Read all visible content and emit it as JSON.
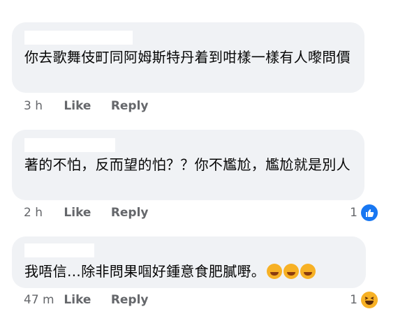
{
  "comments": [
    {
      "text": "你去歌舞伎町同阿姆斯特丹着到咁樣一樣有人嚟問價",
      "time": "3 h",
      "like_label": "Like",
      "reply_label": "Reply",
      "reaction_count": ""
    },
    {
      "text": "著的不怕，反而望的怕？？你不尷尬，尷尬就是別人",
      "time": "2 h",
      "like_label": "Like",
      "reply_label": "Reply",
      "reaction_count": "1",
      "reaction_icon": "like-icon"
    },
    {
      "text": "我唔信…除非問果啯好鍾意食肥膩嘢。",
      "time": "47 m",
      "like_label": "Like",
      "reply_label": "Reply",
      "reaction_count": "1",
      "reaction_icon": "haha-icon",
      "trailing_emojis": [
        "joy-emoji",
        "rofl-emoji",
        "rofl-emoji"
      ]
    }
  ],
  "colors": {
    "bubble": "#f0f2f5",
    "meta_text": "#65676b",
    "like_blue": "#1877f2",
    "haha_yellow": "#f7b125"
  }
}
